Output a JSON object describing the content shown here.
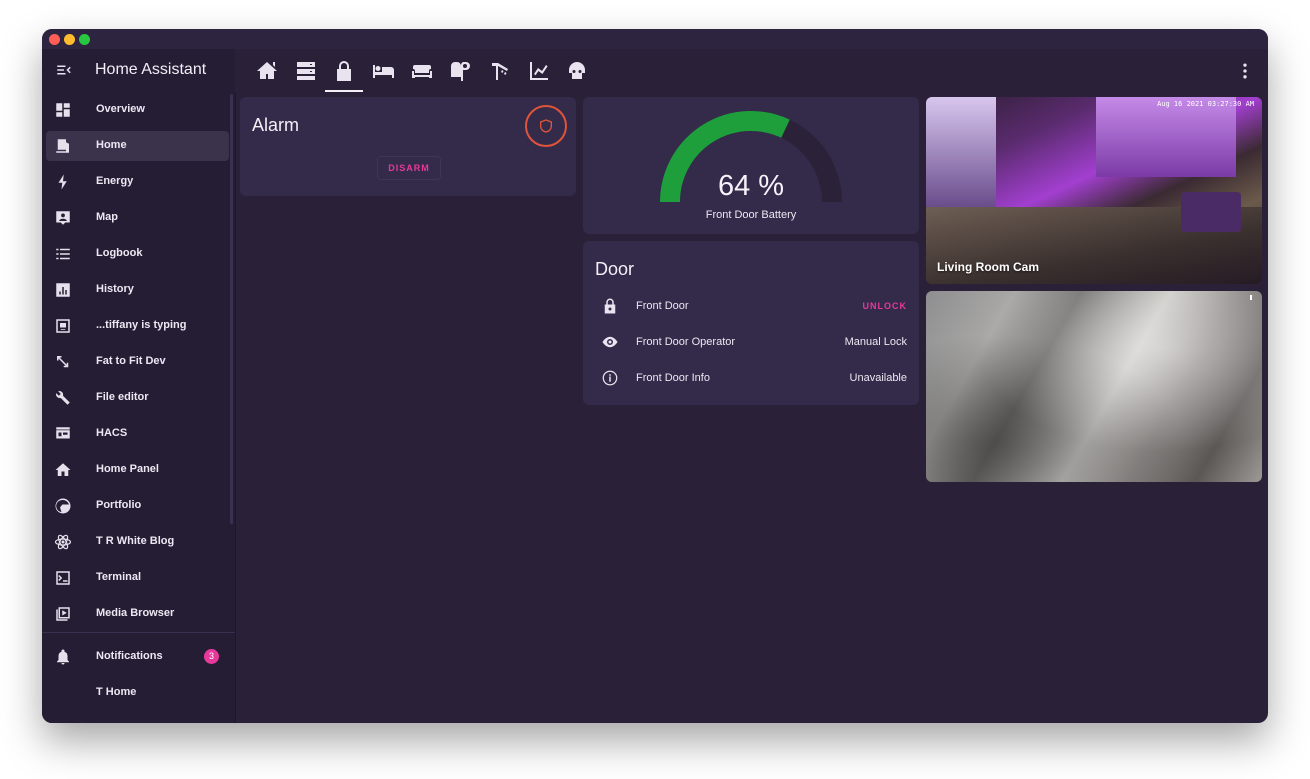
{
  "app": {
    "title": "Home Assistant"
  },
  "sidebar": {
    "items": [
      {
        "label": "Overview",
        "icon": "dashboard-icon"
      },
      {
        "label": "Home",
        "icon": "home-monitor-icon",
        "active": true
      },
      {
        "label": "Energy",
        "icon": "lightning-bolt-icon"
      },
      {
        "label": "Map",
        "icon": "map-account-icon"
      },
      {
        "label": "Logbook",
        "icon": "list-icon"
      },
      {
        "label": "History",
        "icon": "chart-box-icon"
      },
      {
        "label": "...tiffany is typing",
        "icon": "tablet-icon"
      },
      {
        "label": "Fat to Fit Dev",
        "icon": "resize-arrows-icon"
      },
      {
        "label": "File editor",
        "icon": "wrench-icon"
      },
      {
        "label": "HACS",
        "icon": "hacs-store-icon"
      },
      {
        "label": "Home Panel",
        "icon": "house-icon"
      },
      {
        "label": "Portfolio",
        "icon": "globe-icon"
      },
      {
        "label": "T R White Blog",
        "icon": "atom-icon"
      },
      {
        "label": "Terminal",
        "icon": "console-icon"
      },
      {
        "label": "Media Browser",
        "icon": "play-box-icon"
      }
    ],
    "notifications": {
      "label": "Notifications",
      "count": "3",
      "icon": "bell-icon"
    },
    "user": {
      "label": "T Home"
    }
  },
  "tabs": [
    {
      "icon": "home-roof-icon"
    },
    {
      "icon": "server-icon"
    },
    {
      "icon": "lock-icon",
      "active": true
    },
    {
      "icon": "bed-icon"
    },
    {
      "icon": "sofa-icon"
    },
    {
      "icon": "toilet-paper-icon"
    },
    {
      "icon": "shower-icon"
    },
    {
      "icon": "chart-line-icon"
    },
    {
      "icon": "robot-head-icon"
    }
  ],
  "alarm": {
    "title": "Alarm",
    "action": "DISARM",
    "icon": "shield-icon"
  },
  "gauge": {
    "value": 64,
    "display": "64 %",
    "name": "Front Door Battery",
    "color_fill": "#1e9f3c"
  },
  "door": {
    "title": "Door",
    "rows": [
      {
        "name": "Front Door",
        "state": "UNLOCK",
        "icon": "lock-icon"
      },
      {
        "name": "Front Door Operator",
        "state": "Manual Lock",
        "icon": "eye-icon"
      },
      {
        "name": "Front Door Info",
        "state": "Unavailable",
        "icon": "info-icon"
      }
    ]
  },
  "cameras": [
    {
      "label": "Living Room Cam",
      "timestamp": "Aug 16 2021  03:27:30 AM"
    },
    {
      "label": ""
    }
  ],
  "colors": {
    "accent": "#e6399b",
    "background": "#2a2139",
    "card": "#342a4a",
    "sidebar": "#251d33",
    "alarm_ring": "#e0543a"
  }
}
